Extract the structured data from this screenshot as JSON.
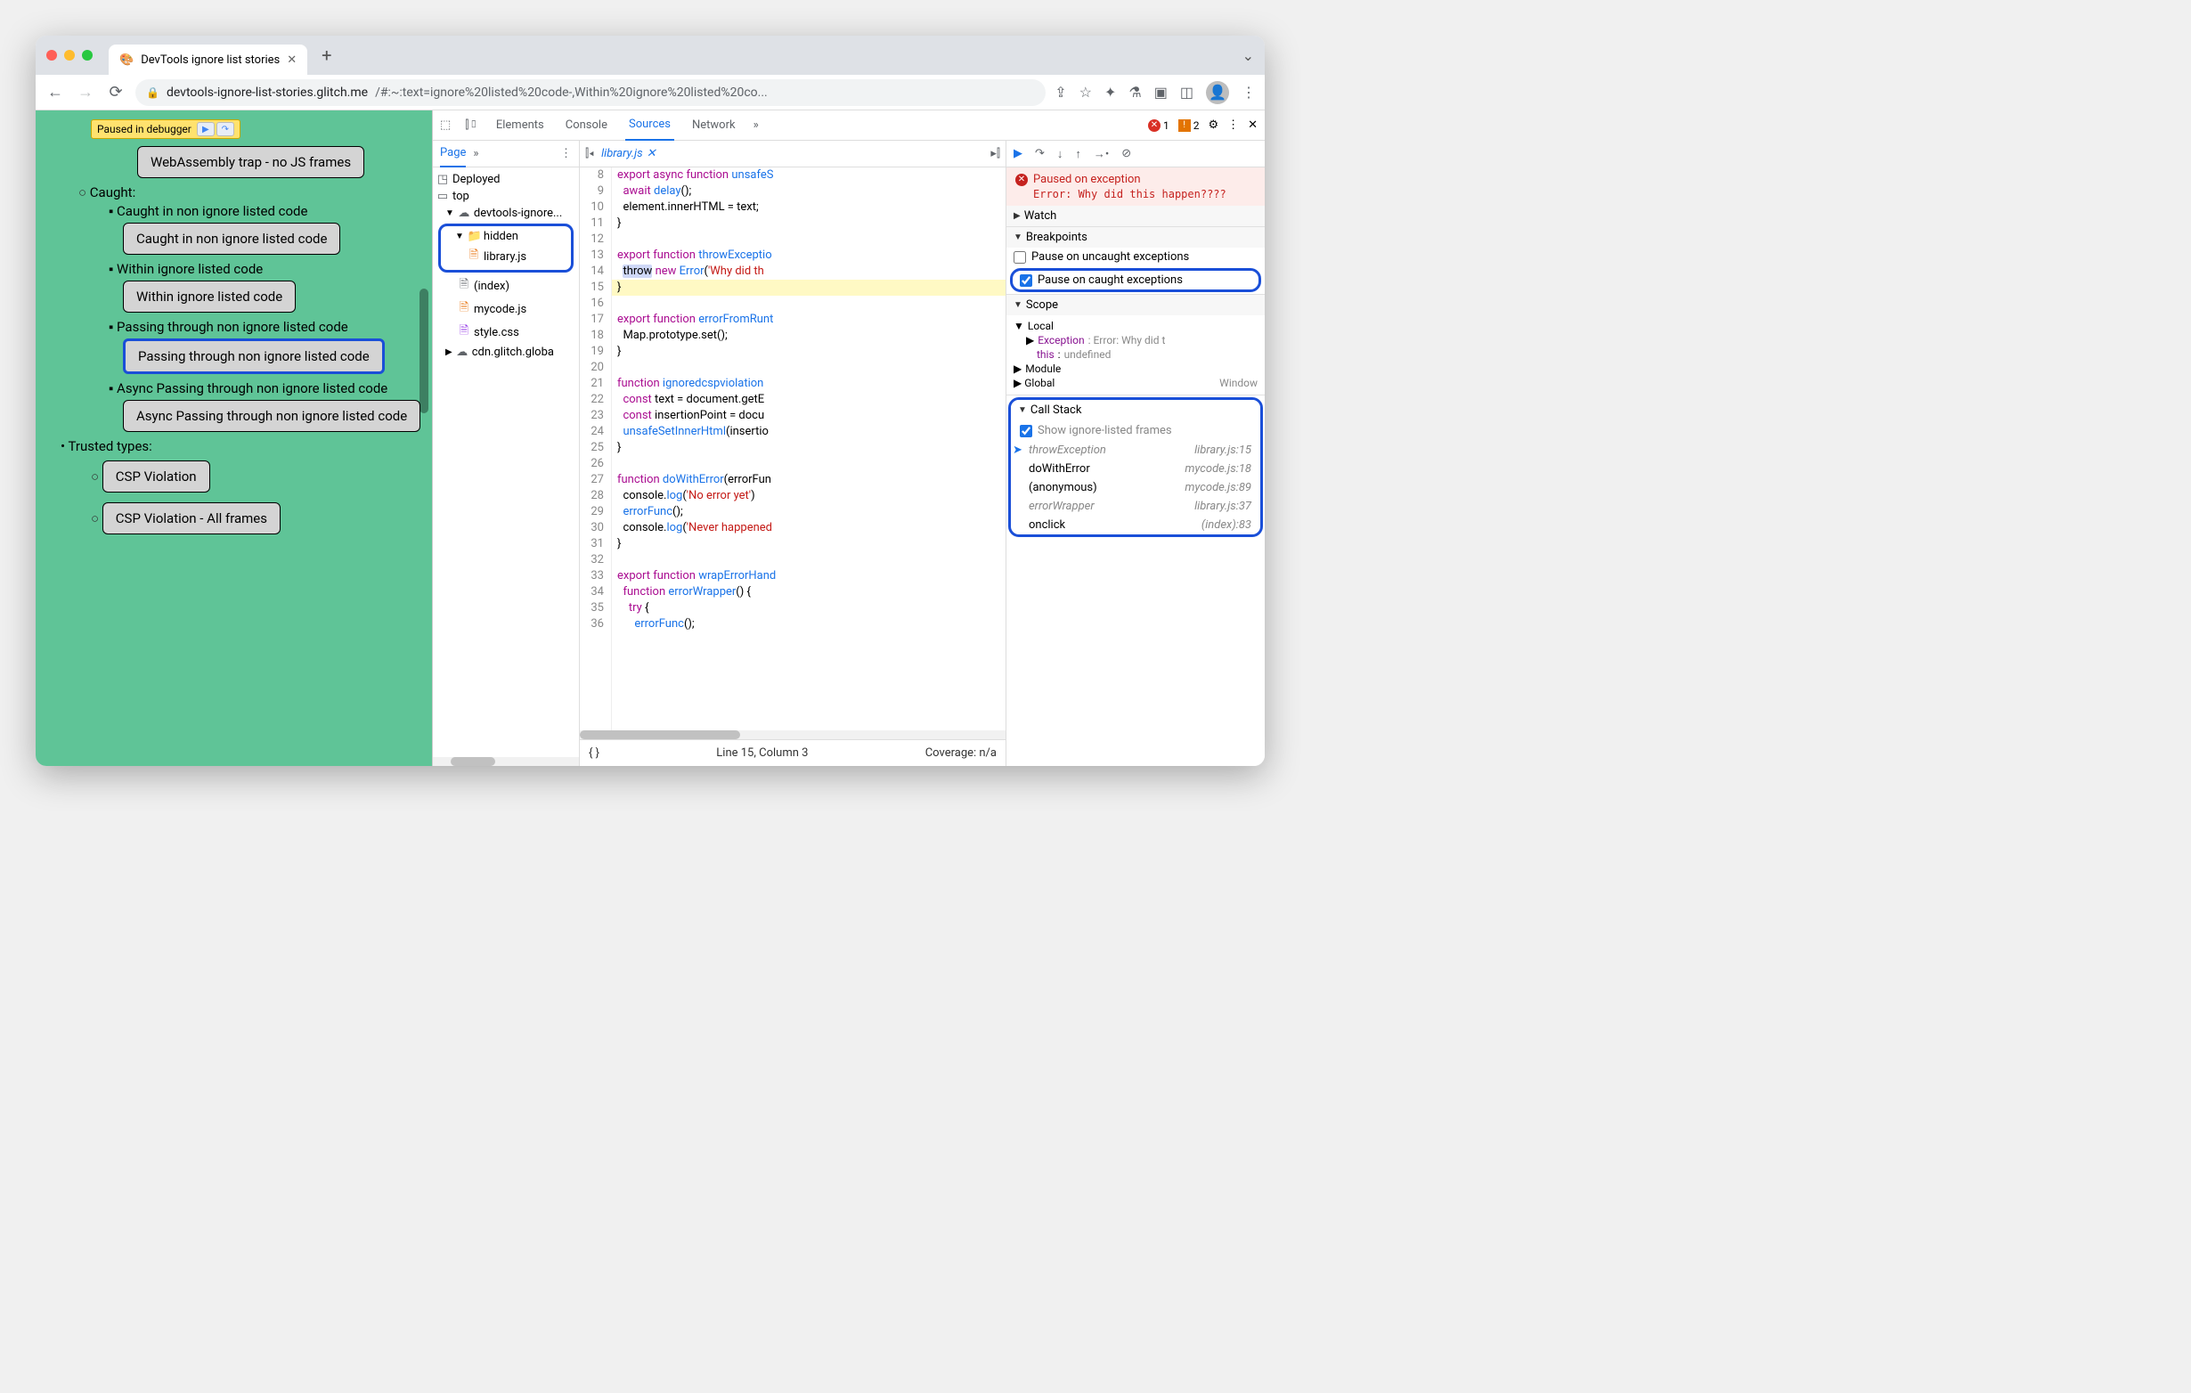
{
  "titlebar": {
    "tab_title": "DevTools ignore list stories"
  },
  "url": {
    "domain": "devtools-ignore-list-stories.glitch.me",
    "path": "/#:~:text=ignore%20listed%20code-,Within%20ignore%20listed%20co..."
  },
  "paused_badge": "Paused in debugger",
  "page_content": {
    "btn_wasm": "WebAssembly trap - no JS frames",
    "caught_header": "Caught:",
    "li_caught": "Caught in non ignore listed code",
    "btn_caught": "Caught in non ignore listed code",
    "li_within": "Within ignore listed code",
    "btn_within": "Within ignore listed code",
    "li_passing": "Passing through non ignore listed code",
    "btn_passing": "Passing through non ignore listed code",
    "li_async": "Async Passing through non ignore listed code",
    "btn_async": "Async Passing through non ignore listed code",
    "trusted_header": "Trusted types:",
    "btn_csp1": "CSP Violation",
    "btn_csp2": "CSP Violation - All frames"
  },
  "devtools": {
    "tabs": [
      "Elements",
      "Console",
      "Sources",
      "Network"
    ],
    "errors": "1",
    "warnings": "2",
    "left_tab": "Page",
    "tree": {
      "deployed": "Deployed",
      "top": "top",
      "origin": "devtools-ignore...",
      "hidden": "hidden",
      "library": "library.js",
      "index": "(index)",
      "mycode": "mycode.js",
      "style": "style.css",
      "cdn": "cdn.glitch.globa"
    },
    "open_file": "library.js",
    "gutter_start": 8,
    "code_lines": [
      "<span class='kw'>export</span> <span class='kw'>async</span> <span class='kw'>function</span> <span class='fn'>unsafeS</span>",
      "  <span class='kw'>await</span> <span class='fn'>delay</span>();",
      "  element.innerHTML = text;",
      "}",
      "",
      "<span class='kw'>export</span> <span class='kw'>function</span> <span class='fn'>throwExceptio</span>",
      "  <span class='pause-word'>throw</span> <span class='kw'>new</span> <span class='fn'>Error</span>(<span class='str'>'Why did th</span>",
      "}",
      "",
      "<span class='kw'>export</span> <span class='kw'>function</span> <span class='fn'>errorFromRunt</span>",
      "  Map.prototype.set();",
      "}",
      "",
      "<span class='kw'>function</span> <span class='fn'>ignoredcspviolation</span>",
      "  <span class='kw'>const</span> text = document.getE",
      "  <span class='kw'>const</span> insertionPoint = docu",
      "  <span class='fn'>unsafeSetInnerHtml</span>(insertio",
      "}",
      "",
      "<span class='kw'>function</span> <span class='fn'>doWithError</span>(errorFun",
      "  console.<span class='fn'>log</span>(<span class='str'>'No error yet'</span>)",
      "  <span class='fn'>errorFunc</span>();",
      "  console.<span class='fn'>log</span>(<span class='str'>'Never happened</span>",
      "}",
      "",
      "<span class='kw'>export</span> <span class='kw'>function</span> <span class='fn'>wrapErrorHand</span>",
      "  <span class='kw'>function</span> <span class='fn'>errorWrapper</span>() {",
      "    <span class='kw'>try</span> {",
      "      <span class='fn'>errorFunc</span>();"
    ],
    "status_line": "Line 15, Column 3",
    "status_coverage": "Coverage: n/a",
    "exception": {
      "title": "Paused on exception",
      "msg": "Error: Why did this happen????"
    },
    "panels": {
      "watch": "Watch",
      "breakpoints": "Breakpoints",
      "scope": "Scope",
      "callstack": "Call Stack",
      "local": "Local",
      "module": "Module",
      "global": "Global"
    },
    "bp": {
      "uncaught": "Pause on uncaught exceptions",
      "caught": "Pause on caught exceptions"
    },
    "scope": {
      "exception_k": "Exception",
      "exception_v": ": Error: Why did t",
      "this_k": "this",
      "this_v": "undefined",
      "global_v": "Window"
    },
    "show_frames": "Show ignore-listed frames",
    "callstack": [
      {
        "name": "throwException",
        "loc": "library.js:15",
        "cls": "active ignored"
      },
      {
        "name": "doWithError",
        "loc": "mycode.js:18",
        "cls": ""
      },
      {
        "name": "(anonymous)",
        "loc": "mycode.js:89",
        "cls": ""
      },
      {
        "name": "errorWrapper",
        "loc": "library.js:37",
        "cls": "ignored"
      },
      {
        "name": "onclick",
        "loc": "(index):83",
        "cls": ""
      }
    ]
  }
}
